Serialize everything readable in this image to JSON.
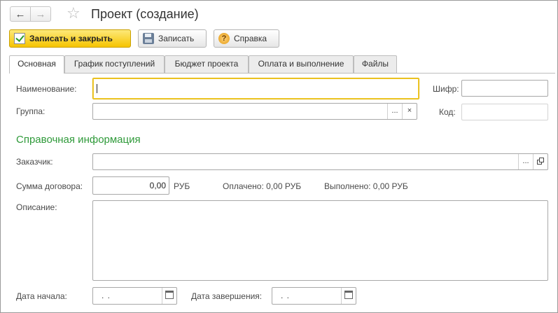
{
  "window": {
    "title": "Проект (создание)"
  },
  "nav": {
    "back_icon": "←",
    "forward_icon": "→",
    "favorite_icon": "☆"
  },
  "toolbar": {
    "save_close_label": "Записать и закрыть",
    "save_label": "Записать",
    "help_label": "Справка"
  },
  "tabs": [
    {
      "label": "Основная",
      "active": true
    },
    {
      "label": "График поступлений",
      "active": false
    },
    {
      "label": "Бюджет проекта",
      "active": false
    },
    {
      "label": "Оплата и выполнение",
      "active": false
    },
    {
      "label": "Файлы",
      "active": false
    }
  ],
  "form": {
    "name_label": "Наименование:",
    "name_value": "",
    "code_cipher_label": "Шифр:",
    "code_cipher_value": "",
    "group_label": "Группа:",
    "group_value": "",
    "group_choose_btn": "...",
    "group_clear_btn": "×",
    "code_label": "Код:",
    "code_value": "",
    "section_title": "Справочная информация",
    "customer_label": "Заказчик:",
    "customer_value": "",
    "customer_choose_btn": "...",
    "contract_sum_label": "Сумма договора:",
    "contract_sum_value": "0,00",
    "currency": "РУБ",
    "paid_text": "Оплачено: 0,00 РУБ",
    "done_text": "Выполнено: 0,00 РУБ",
    "description_label": "Описание:",
    "description_value": "",
    "start_date_label": "Дата начала:",
    "start_date_value": " .  .",
    "end_date_label": "Дата завершения:",
    "end_date_value": " .  ."
  }
}
